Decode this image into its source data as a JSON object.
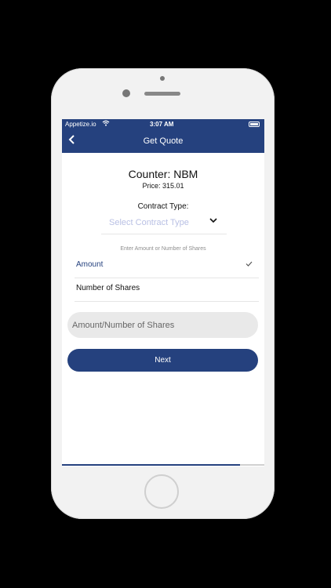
{
  "status_bar": {
    "carrier": "Appetize.io",
    "wifi_icon": "wifi-icon",
    "time": "3:07 AM",
    "battery_icon": "battery-icon"
  },
  "nav": {
    "back_icon": "chevron-left-icon",
    "title": "Get Quote"
  },
  "quote": {
    "counter": "Counter: NBM",
    "price": "Price: 315.01"
  },
  "contract": {
    "label": "Contract Type:",
    "placeholder": "Select Contract Type",
    "chevron_icon": "chevron-down-icon"
  },
  "hint": "Enter Amount or Number of Shares",
  "options": [
    {
      "label": "Amount",
      "selected": true
    },
    {
      "label": "Number of Shares",
      "selected": false
    }
  ],
  "input": {
    "placeholder": "Amount/Number of Shares",
    "value": ""
  },
  "next_label": "Next",
  "progress": 0.88,
  "colors": {
    "primary": "#25417e",
    "placeholder_blue": "#b9c0e4",
    "input_bg": "#e9e9e9"
  }
}
